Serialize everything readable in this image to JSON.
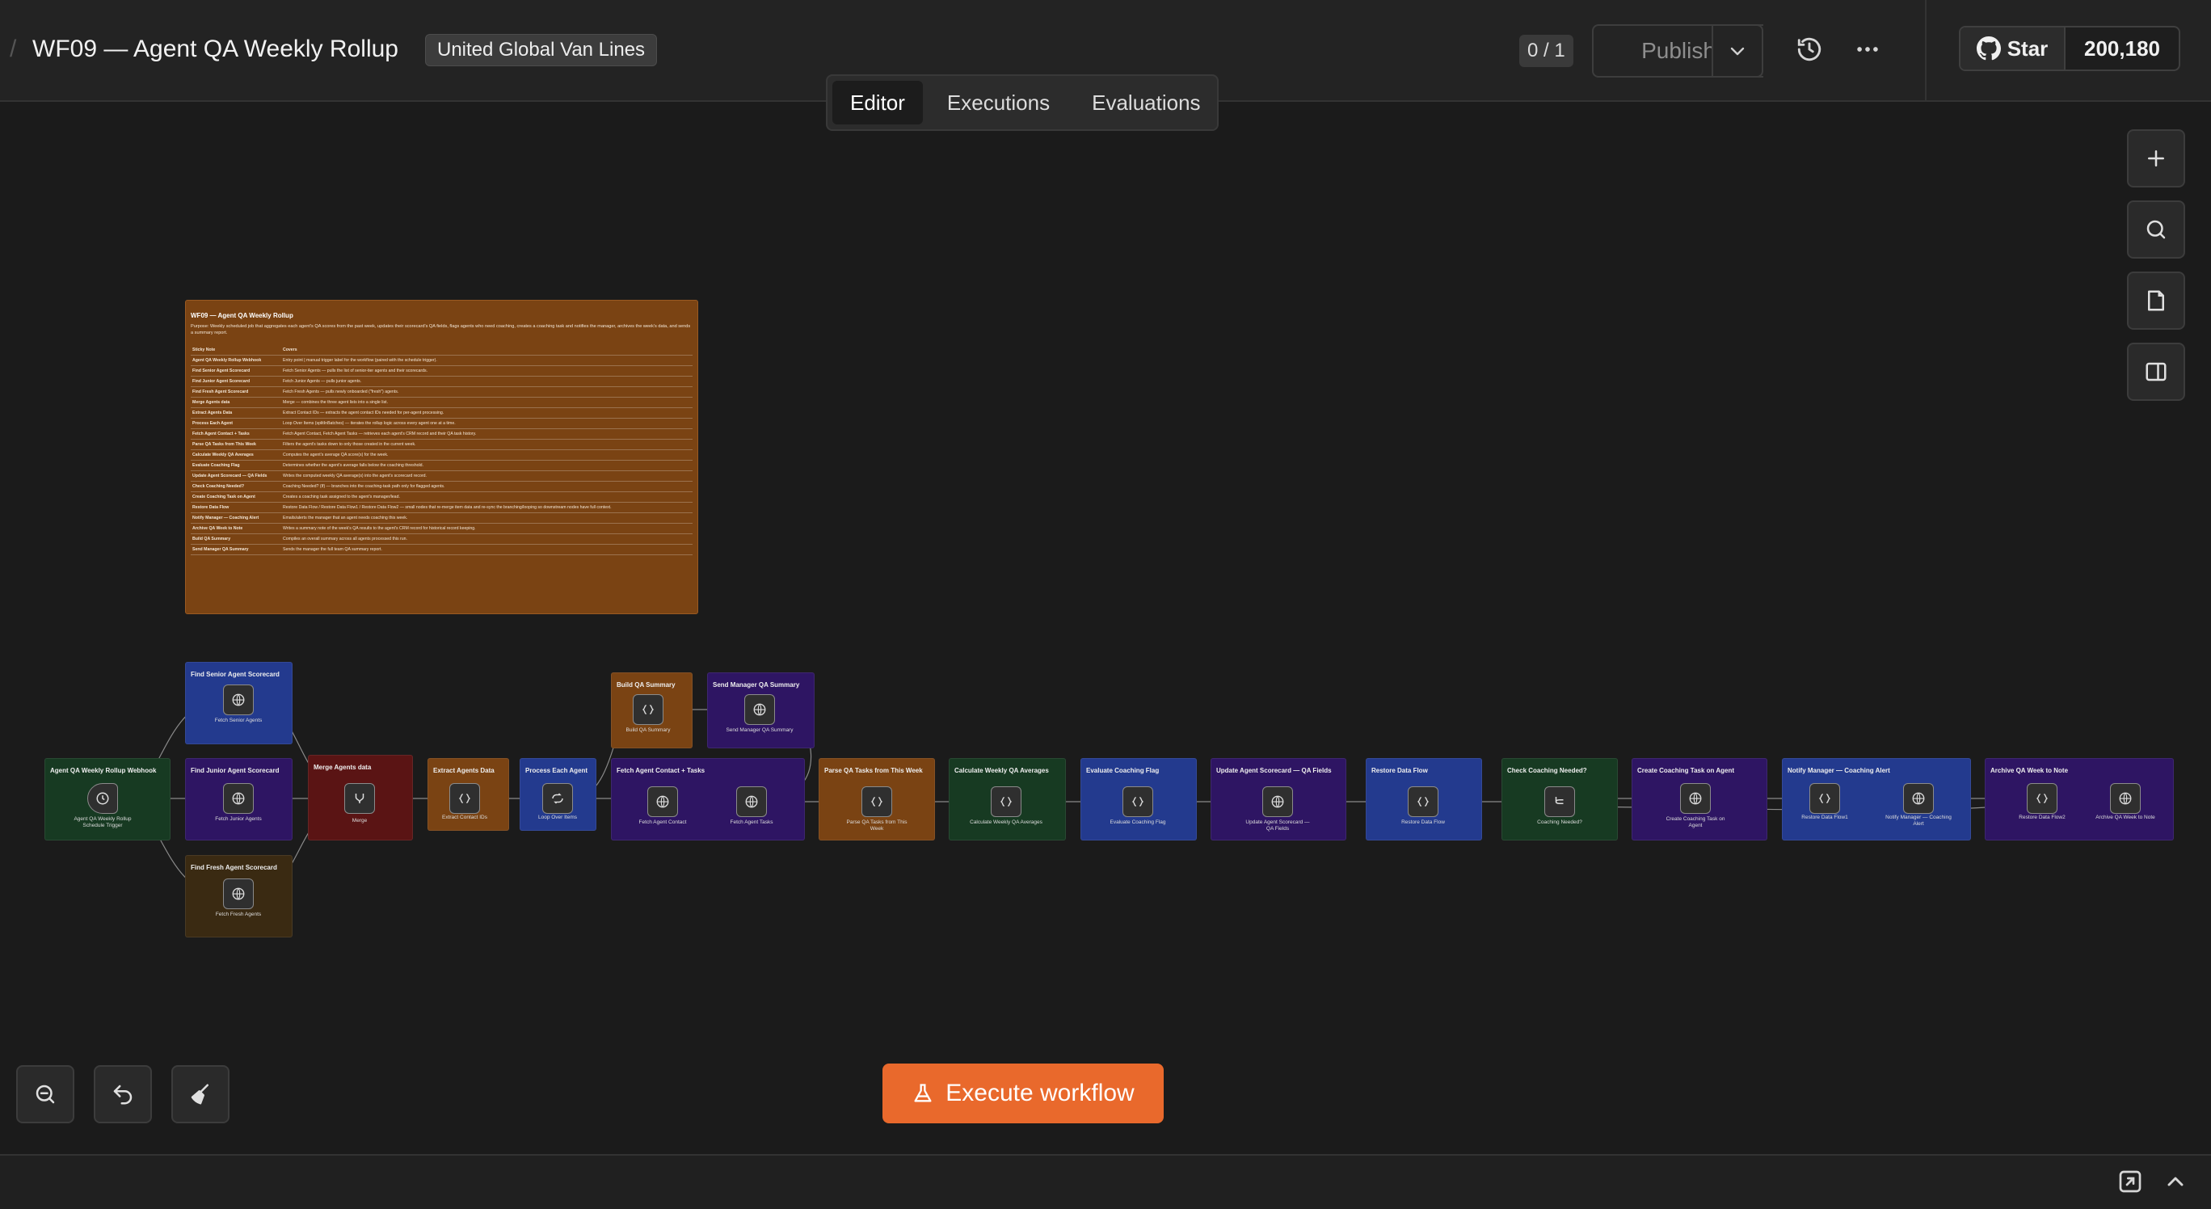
{
  "header": {
    "workflow_title": "WF09 — Agent QA Weekly Rollup",
    "tag": "United Global Van Lines",
    "counter": "0 / 1",
    "publish_label": "Publish",
    "github_star_label": "Star",
    "github_star_count": "200,180"
  },
  "tabs": [
    {
      "label": "Editor",
      "active": true
    },
    {
      "label": "Executions",
      "active": false
    },
    {
      "label": "Evaluations",
      "active": false
    }
  ],
  "execute_label": "Execute workflow",
  "doc": {
    "title": "WF09 — Agent QA Weekly Rollup",
    "purpose": "Purpose: Weekly scheduled job that aggregates each agent's QA scores from the past week, updates their scorecard's QA fields, flags agents who need coaching, creates a coaching task and notifies the manager, archives the week's data, and sends a summary report.",
    "col1": "Sticky Note",
    "col2": "Covers",
    "rows": [
      [
        "Agent QA Weekly Rollup Webhook",
        "Entry point | manual trigger label for the workflow (paired with the schedule trigger)."
      ],
      [
        "Find Senior Agent Scorecard",
        "Fetch Senior Agents — pulls the list of senior-tier agents and their scorecards."
      ],
      [
        "Find Junior Agent Scorecard",
        "Fetch Junior Agents — pulls junior agents."
      ],
      [
        "Find Fresh Agent Scorecard",
        "Fetch Fresh Agents — pulls newly onboarded (\"fresh\") agents."
      ],
      [
        "Merge Agents data",
        "Merge — combines the three agent lists into a single list."
      ],
      [
        "Extract Agents Data",
        "Extract Contact IDs — extracts the agent contact IDs needed for per-agent processing."
      ],
      [
        "Process Each Agent",
        "Loop Over Items (splitInBatches) — iterates the rollup logic across every agent one at a time."
      ],
      [
        "Fetch Agent Contact + Tasks",
        "Fetch Agent Contact, Fetch Agent Tasks — retrieves each agent's CRM record and their QA task history."
      ],
      [
        "Parse QA Tasks from This Week",
        "Filters the agent's tasks down to only those created in the current week."
      ],
      [
        "Calculate Weekly QA Averages",
        "Computes the agent's average QA score(s) for the week."
      ],
      [
        "Evaluate Coaching Flag",
        "Determines whether the agent's average falls below the coaching threshold."
      ],
      [
        "Update Agent Scorecard — QA Fields",
        "Writes the computed weekly QA average(s) into the agent's scorecard record."
      ],
      [
        "Check Coaching Needed?",
        "Coaching Needed? (If) — branches into the coaching-task path only for flagged agents."
      ],
      [
        "Create Coaching Task on Agent",
        "Creates a coaching task assigned to the agent's manager/lead."
      ],
      [
        "Restore Data Flow",
        "Restore Data Flow / Restore Data Flow1 / Restore Data Flow2 — small nodes that re-merge item data and re-sync the branching/looping so downstream nodes have full context."
      ],
      [
        "Notify Manager — Coaching Alert",
        "Emails/alerts the manager that an agent needs coaching this week."
      ],
      [
        "Archive QA Week to Note",
        "Writes a summary note of the week's QA results to the agent's CRM record for historical record keeping."
      ],
      [
        "Build QA Summary",
        "Compiles an overall summary across all agents processed this run."
      ],
      [
        "Send Manager QA Summary",
        "Sends the manager the full team QA summary report."
      ]
    ]
  },
  "stickies": {
    "trigger": "Agent QA Weekly Rollup Webhook",
    "senior": "Find Senior Agent Scorecard",
    "junior": "Find Junior Agent Scorecard",
    "fresh": "Find Fresh Agent Scorecard",
    "merge": "Merge Agents data",
    "extract": "Extract Agents Data",
    "process": "Process Each Agent",
    "build": "Build QA Summary",
    "send": "Send Manager QA Summary",
    "fetch": "Fetch Agent Contact + Tasks",
    "parse": "Parse QA Tasks from This Week",
    "calc": "Calculate Weekly QA Averages",
    "evaluate": "Evaluate Coaching Flag",
    "update": "Update Agent Scorecard — QA Fields",
    "restore": "Restore Data Flow",
    "check": "Check Coaching Needed?",
    "create": "Create Coaching Task on Agent",
    "notify": "Notify Manager — Coaching Alert",
    "archive": "Archive QA Week to Note"
  },
  "nodes": {
    "trigger": "Agent QA Weekly Rollup Schedule Trigger",
    "senior": "Fetch Senior Agents",
    "junior": "Fetch Junior Agents",
    "fresh": "Fetch Fresh Agents",
    "merge": "Merge",
    "extract": "Extract Contact IDs",
    "loop": "Loop Over Items",
    "build": "Build QA Summary",
    "send": "Send Manager QA Summary",
    "contact": "Fetch Agent Contact",
    "tasks": "Fetch Agent Tasks",
    "parse": "Parse QA Tasks from This Week",
    "calc": "Calculate Weekly QA Averages",
    "evaluate": "Evaluate Coaching Flag",
    "update": "Update Agent Scorecard — QA Fields",
    "restore": "Restore Data Flow",
    "coaching": "Coaching Needed?",
    "create": "Create Coaching Task on Agent",
    "restore1": "Restore Data Flow1",
    "notify": "Notify Manager — Coaching Alert",
    "restore2": "Restore Data Flow2",
    "archive": "Archive QA Week to Note"
  },
  "colors": {
    "accent": "#e9692c",
    "sticky_orange": "#7a4313",
    "sticky_blue": "#233a8e",
    "sticky_purple": "#2e1563",
    "sticky_green": "#173a22",
    "sticky_red": "#5a1414",
    "sticky_brown": "#3a2a12"
  }
}
